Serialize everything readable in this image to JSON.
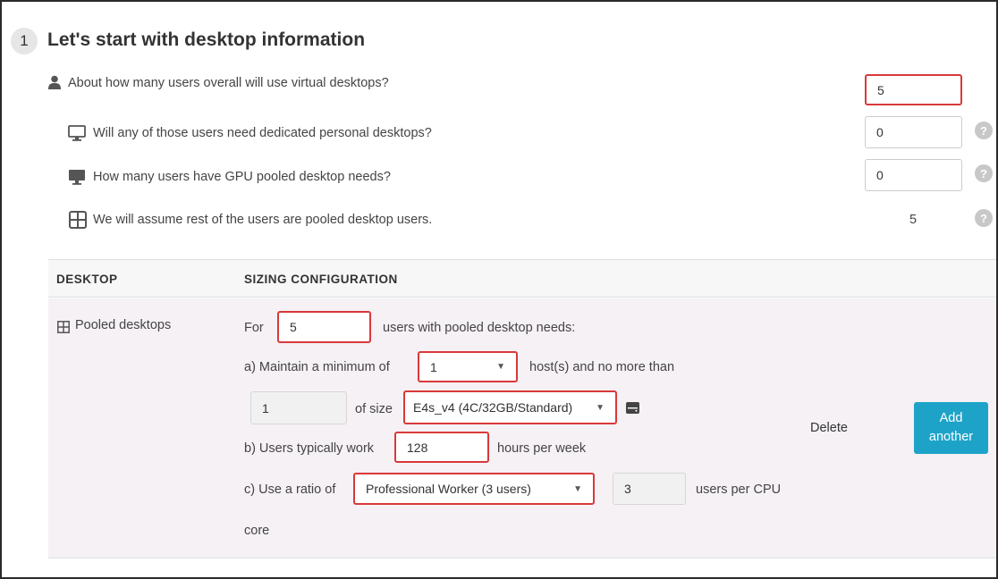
{
  "section": {
    "step_number": "1",
    "title": "Let's start with desktop information"
  },
  "questions": {
    "total_users": {
      "label": "About how many users overall will use virtual desktops?",
      "value": "5",
      "icon": "user-icon"
    },
    "personal": {
      "label": "Will any of those users need dedicated personal desktops?",
      "value": "0",
      "icon": "monitor-icon"
    },
    "gpu": {
      "label": "How many users have GPU pooled desktop needs?",
      "value": "0",
      "icon": "monitor-filled-icon"
    },
    "pooled": {
      "label": "We will assume rest of the users are pooled desktop users.",
      "value": "5",
      "icon": "grid-icon"
    },
    "help_glyph": "?"
  },
  "table": {
    "col_desktop": "DESKTOP",
    "col_sizing": "SIZING CONFIGURATION"
  },
  "row": {
    "desktop_label": "Pooled desktops",
    "for_label": "For",
    "for_value": "5",
    "for_suffix": "users with pooled desktop needs:",
    "a_label": "a) Maintain a minimum of",
    "a_value": "1",
    "a_suffix": "host(s) and no more than",
    "max_hosts": "1",
    "of_size": "of size",
    "size_value": "E4s_v4 (4C/32GB/Standard)",
    "b_label": "b) Users typically work",
    "b_value": "128",
    "b_suffix": "hours per week",
    "c_label": "c) Use a ratio of",
    "c_value": "Professional Worker (3 users)",
    "c_ratio": "3",
    "c_suffix": "users per CPU",
    "c_suffix2": "core",
    "delete_label": "Delete",
    "add_label": "Add another"
  },
  "colors": {
    "highlight": "#d9383a",
    "accent_button": "#1ea3c8",
    "row_background": "#f5f1f5"
  }
}
